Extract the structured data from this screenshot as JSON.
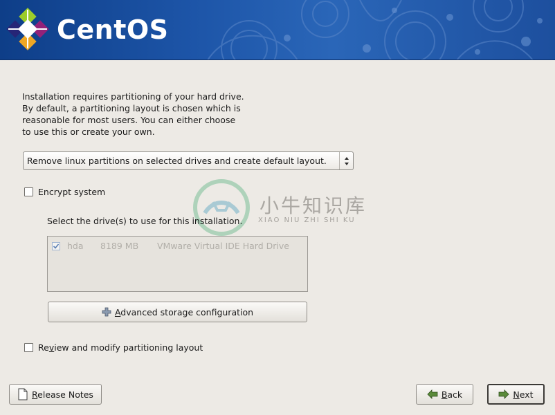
{
  "header": {
    "brand": "CentOS",
    "logo_icon": "centos-logo-icon"
  },
  "intro": {
    "lines": [
      "Installation requires partitioning of your hard drive.",
      "By default, a partitioning layout is chosen which is",
      "reasonable for most users.  You can either choose",
      "to use this or create your own."
    ]
  },
  "partition_layout": {
    "selected": "Remove linux partitions on selected drives and create default layout."
  },
  "encrypt": {
    "label": "Encrypt system",
    "checked": false
  },
  "drives": {
    "label": "Select the drive(s) to use for this installation.",
    "items": [
      {
        "checked": true,
        "name": "hda",
        "size": "8189 MB",
        "model": "VMware Virtual IDE Hard Drive"
      }
    ]
  },
  "advanced": {
    "label_prefix": "",
    "accel": "A",
    "label_rest": "dvanced storage configuration",
    "icon": "plus-icon"
  },
  "review": {
    "label_pre": "Re",
    "accel": "v",
    "label_post": "iew and modify partitioning layout",
    "checked": false
  },
  "footer": {
    "release_notes": {
      "accel": "R",
      "rest": "elease Notes",
      "icon": "document-icon"
    },
    "back": {
      "accel": "B",
      "rest": "ack",
      "icon": "arrow-left-icon"
    },
    "next": {
      "accel": "N",
      "rest": "ext",
      "icon": "arrow-right-icon"
    }
  },
  "watermark": {
    "text": "小牛知识库",
    "sub": "XIAO NIU ZHI SHI KU"
  },
  "colors": {
    "banner": "#1d55a8",
    "background": "#edeae5"
  }
}
